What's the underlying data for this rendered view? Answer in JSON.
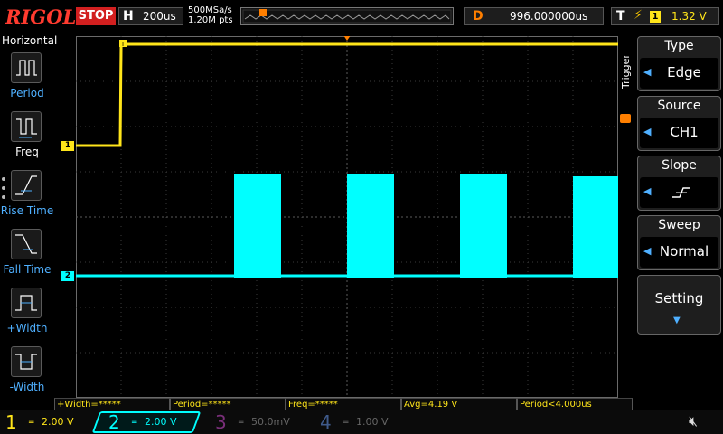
{
  "topbar": {
    "brand": "RIGOL",
    "run_state": "STOP",
    "h_key": "H",
    "timebase": "200us",
    "sample_rate": "500MSa/s",
    "memory_depth": "1.20M pts",
    "delay_key": "D",
    "delay": "996.000000us",
    "trig_key": "T",
    "trig_channel": "1",
    "trig_level": "1.32 V"
  },
  "left_menu": {
    "title": "Horizontal",
    "items": [
      {
        "label": "Period",
        "icon": "period-icon"
      },
      {
        "label": "Freq",
        "icon": "freq-icon"
      },
      {
        "label": "Rise Time",
        "icon": "rise-time-icon"
      },
      {
        "label": "Fall Time",
        "icon": "fall-time-icon"
      },
      {
        "label": "+Width",
        "icon": "pos-width-icon"
      },
      {
        "label": "-Width",
        "icon": "neg-width-icon"
      }
    ]
  },
  "right_menu": {
    "section_label": "Trigger",
    "buttons": [
      {
        "title": "Type",
        "value": "Edge"
      },
      {
        "title": "Source",
        "value": "CH1"
      },
      {
        "title": "Slope",
        "value": ""
      },
      {
        "title": "Sweep",
        "value": "Normal"
      }
    ],
    "setting_label": "Setting"
  },
  "markers": {
    "ch1": "1",
    "ch2": "2"
  },
  "measurements": [
    "+Width=*****",
    "Period=*****",
    "Freq=*****",
    "Avg=4.19 V",
    "Period<4.000us"
  ],
  "channels": [
    {
      "num": "1",
      "scale": "2.00 V",
      "color": "#ffe51a"
    },
    {
      "num": "2",
      "scale": "2.00 V",
      "color": "#00ffff"
    },
    {
      "num": "3",
      "scale": "50.0mV",
      "color": "#cc44cc"
    },
    {
      "num": "4",
      "scale": "1.00 V",
      "color": "#3399ff"
    }
  ],
  "colors": {
    "ch1": "#ffe51a",
    "ch2": "#00ffff",
    "accent": "#4fb0ff",
    "stop": "#d21f1f",
    "delay": "#ff7f00"
  }
}
